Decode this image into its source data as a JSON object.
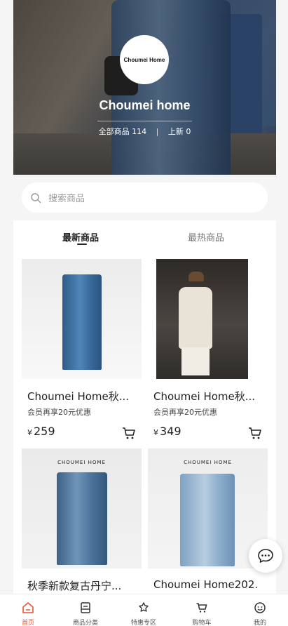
{
  "shop": {
    "logo_text": "Choumei Home",
    "name": "Choumei home",
    "total_label": "全部商品",
    "total_count": "114",
    "divider": "|",
    "new_label": "上新",
    "new_count": "0"
  },
  "search": {
    "placeholder": "搜索商品"
  },
  "tabs": [
    {
      "label": "最新商品",
      "active": true
    },
    {
      "label": "最热商品",
      "active": false
    }
  ],
  "products": [
    {
      "title": "Choumei Home秋...",
      "promo": "会员再享20元优惠",
      "currency": "¥",
      "price": "259"
    },
    {
      "title": "Choumei Home秋...",
      "promo": "会员再享20元优惠",
      "currency": "¥",
      "price": "349"
    },
    {
      "title": "秋季新款复古丹宁...",
      "image_text": "CHOUMEI HOME"
    },
    {
      "title": "Choumei Home202...",
      "image_text": "CHOUMEI HOME"
    }
  ],
  "tabbar": [
    {
      "label": "首页",
      "icon": "home-icon",
      "active": true
    },
    {
      "label": "商品分类",
      "icon": "category-icon",
      "active": false
    },
    {
      "label": "特惠专区",
      "icon": "deal-icon",
      "active": false
    },
    {
      "label": "购物车",
      "icon": "cart-icon",
      "active": false
    },
    {
      "label": "我的",
      "icon": "profile-icon",
      "active": false
    }
  ],
  "colors": {
    "accent": "#e05a3a",
    "text": "#222222"
  }
}
